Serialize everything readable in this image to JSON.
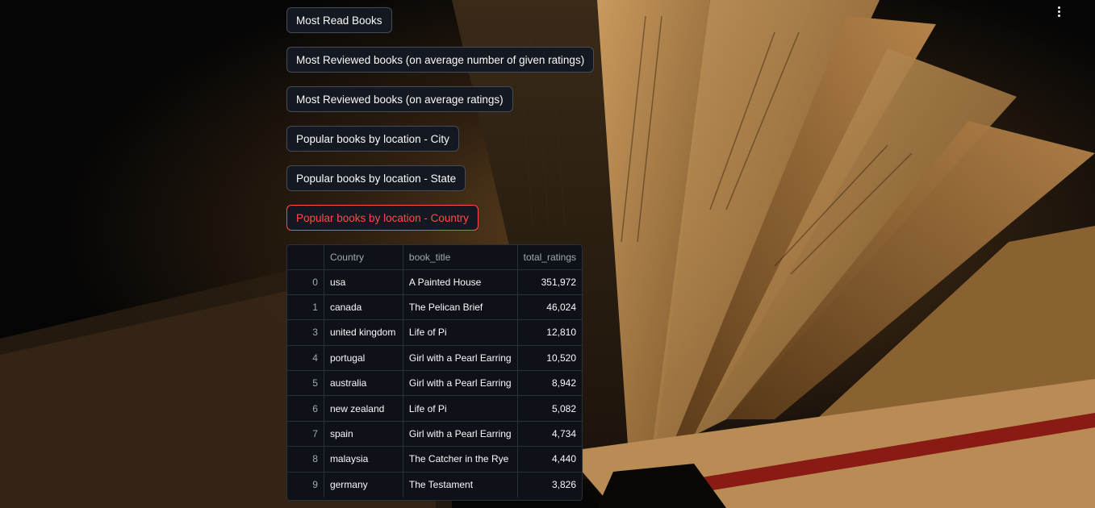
{
  "buttons": [
    {
      "label": "Most Read Books",
      "active": false
    },
    {
      "label": "Most Reviewed books (on average number of given ratings)",
      "active": false
    },
    {
      "label": "Most Reviewed books (on average ratings)",
      "active": false
    },
    {
      "label": "Popular books by location - City",
      "active": false
    },
    {
      "label": "Popular books by location - State",
      "active": false
    },
    {
      "label": "Popular books by location - Country",
      "active": true
    }
  ],
  "table": {
    "columns": [
      "",
      "Country",
      "book_title",
      "total_ratings"
    ],
    "rows": [
      {
        "index": "0",
        "country": "usa",
        "book_title": "A Painted House",
        "total_ratings": "351,972"
      },
      {
        "index": "1",
        "country": "canada",
        "book_title": "The Pelican Brief",
        "total_ratings": "46,024"
      },
      {
        "index": "3",
        "country": "united kingdom",
        "book_title": "Life of Pi",
        "total_ratings": "12,810"
      },
      {
        "index": "4",
        "country": "portugal",
        "book_title": "Girl with a Pearl Earring",
        "total_ratings": "10,520"
      },
      {
        "index": "5",
        "country": "australia",
        "book_title": "Girl with a Pearl Earring",
        "total_ratings": "8,942"
      },
      {
        "index": "6",
        "country": "new zealand",
        "book_title": "Life of Pi",
        "total_ratings": "5,082"
      },
      {
        "index": "7",
        "country": "spain",
        "book_title": "Girl with a Pearl Earring",
        "total_ratings": "4,734"
      },
      {
        "index": "8",
        "country": "malaysia",
        "book_title": "The Catcher in the Rye",
        "total_ratings": "4,440"
      },
      {
        "index": "9",
        "country": "germany",
        "book_title": "The Testament",
        "total_ratings": "3,826"
      }
    ]
  },
  "colors": {
    "accent": "#ff4b4b",
    "button_bg": "#141820",
    "table_bg": "#0e1117"
  },
  "icons": {
    "menu": "kebab-menu-icon",
    "background": "open-book-background-image"
  }
}
